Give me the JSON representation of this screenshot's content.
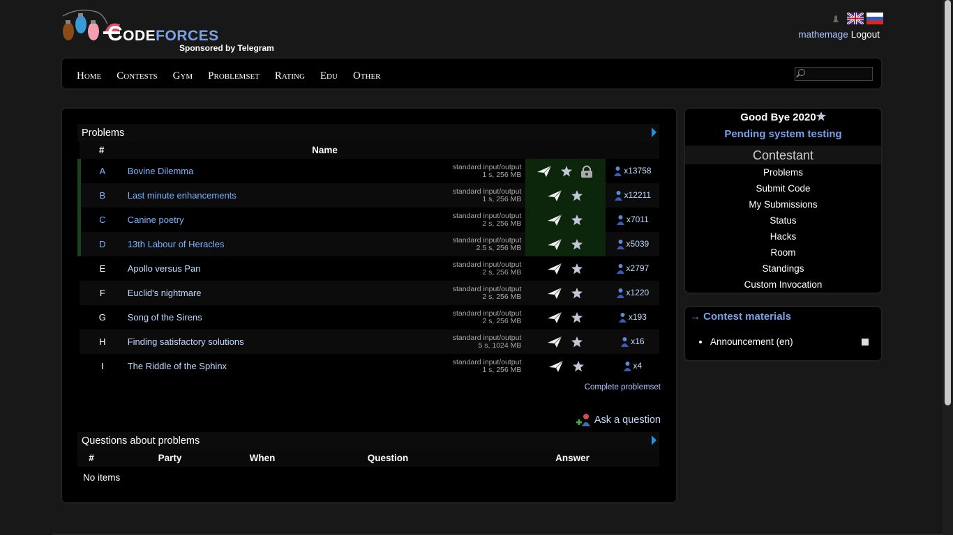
{
  "header": {
    "logo_text_a": "Code",
    "logo_text_b": "forces",
    "sponsor": "Sponsored by Telegram",
    "user": "mathemage",
    "logout": "Logout"
  },
  "menu": {
    "items": [
      "Home",
      "Contests",
      "Gym",
      "Problemset",
      "Rating",
      "Edu",
      "Other"
    ],
    "search_placeholder": ""
  },
  "problems": {
    "title": "Problems",
    "col_num": "#",
    "col_name": "Name",
    "rows": [
      {
        "idx": "A",
        "name": "Bovine Dilemma",
        "io": "standard input/output",
        "limits": "1 s, 256 MB",
        "count": "x13758",
        "accepted": true,
        "locked": true
      },
      {
        "idx": "B",
        "name": "Last minute enhancements",
        "io": "standard input/output",
        "limits": "1 s, 256 MB",
        "count": "x12211",
        "accepted": true,
        "locked": false
      },
      {
        "idx": "C",
        "name": "Canine poetry",
        "io": "standard input/output",
        "limits": "2 s, 256 MB",
        "count": "x7011",
        "accepted": true,
        "locked": false
      },
      {
        "idx": "D",
        "name": "13th Labour of Heracles",
        "io": "standard input/output",
        "limits": "2.5 s, 256 MB",
        "count": "x5039",
        "accepted": true,
        "locked": false
      },
      {
        "idx": "E",
        "name": "Apollo versus Pan",
        "io": "standard input/output",
        "limits": "2 s, 256 MB",
        "count": "x2797",
        "accepted": false,
        "locked": false
      },
      {
        "idx": "F",
        "name": "Euclid's nightmare",
        "io": "standard input/output",
        "limits": "2 s, 256 MB",
        "count": "x1220",
        "accepted": false,
        "locked": false
      },
      {
        "idx": "G",
        "name": "Song of the Sirens",
        "io": "standard input/output",
        "limits": "2 s, 256 MB",
        "count": "x193",
        "accepted": false,
        "locked": false
      },
      {
        "idx": "H",
        "name": "Finding satisfactory solutions",
        "io": "standard input/output",
        "limits": "5 s, 1024 MB",
        "count": "x16",
        "accepted": false,
        "locked": false
      },
      {
        "idx": "I",
        "name": "The Riddle of the Sphinx",
        "io": "standard input/output",
        "limits": "1 s, 256 MB",
        "count": "x4",
        "accepted": false,
        "locked": false
      }
    ],
    "complete_link": "Complete problemset",
    "ask": "Ask a question"
  },
  "questions": {
    "title": "Questions about problems",
    "cols": [
      "#",
      "Party",
      "When",
      "Question",
      "Answer"
    ],
    "empty": "No items"
  },
  "sidebar": {
    "contest": "Good Bye 2020",
    "status": "Pending system testing",
    "role": "Contestant",
    "links": [
      "Problems",
      "Submit Code",
      "My Submissions",
      "Status",
      "Hacks",
      "Room",
      "Standings",
      "Custom Invocation"
    ],
    "materials_title": "→ Contest materials",
    "materials": [
      "Announcement (en)"
    ]
  },
  "colors": {
    "accent": "#7aa1e8",
    "accepted_bg": "#0b260b",
    "link": "#c0dbff"
  }
}
